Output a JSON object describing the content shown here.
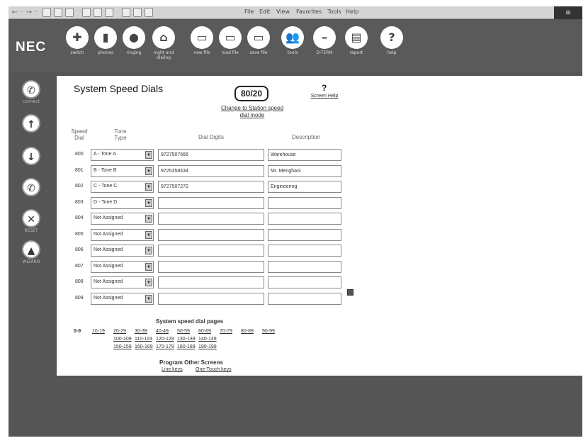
{
  "menu": {
    "nav": [
      "←",
      "·",
      "→",
      "·"
    ],
    "items": [
      "File",
      "Edit",
      "View",
      "Favorites",
      "Tools",
      "Help"
    ]
  },
  "brand": {
    "logo": "NEC"
  },
  "toolbar": [
    {
      "id": "switch",
      "icon": "plus-icon",
      "glyph": "✚",
      "label": "switch"
    },
    {
      "id": "phones",
      "icon": "phone-icon",
      "glyph": "▮",
      "label": "phones"
    },
    {
      "id": "ringing",
      "icon": "ringing-icon",
      "glyph": "●",
      "label": "ringing"
    },
    {
      "id": "night",
      "icon": "lock-icon",
      "glyph": "⌂",
      "label": "night and dialing"
    },
    {
      "id": "newfile",
      "icon": "folder-new-icon",
      "glyph": "▭",
      "label": "new file"
    },
    {
      "id": "loadfile",
      "icon": "folder-open-icon",
      "glyph": "▭",
      "label": "load file"
    },
    {
      "id": "savefile",
      "icon": "folder-save-icon",
      "glyph": "▭",
      "label": "save file"
    },
    {
      "id": "tools",
      "icon": "people-icon",
      "glyph": "👥",
      "label": "tools"
    },
    {
      "id": "dterm",
      "icon": "dterm-icon",
      "glyph": "–",
      "label": "D-TERM"
    },
    {
      "id": "report",
      "icon": "report-icon",
      "glyph": "▤",
      "label": "report"
    },
    {
      "id": "help",
      "icon": "help-icon",
      "glyph": "?",
      "label": "help"
    }
  ],
  "sidebar": [
    {
      "id": "connect",
      "icon": "connect-icon",
      "glyph": "✆",
      "label": "connect"
    },
    {
      "id": "upload",
      "icon": "up-arrow-icon",
      "glyph": "↑",
      "label": ""
    },
    {
      "id": "download",
      "icon": "down-arrow-icon",
      "glyph": "↓",
      "label": ""
    },
    {
      "id": "disconnect",
      "icon": "disconnect-icon",
      "glyph": "✆",
      "label": ""
    },
    {
      "id": "reset",
      "icon": "reset-icon",
      "glyph": "✕",
      "label": "RESET"
    },
    {
      "id": "wizard",
      "icon": "wizard-icon",
      "glyph": "▲",
      "label": "WIZARD"
    }
  ],
  "page": {
    "title": "System Speed Dials",
    "mode": "80/20",
    "change_mode": "Change to Station speed dial mode",
    "help_q": "?",
    "screen_help": "Screen Help",
    "headers": {
      "speed_dial": "Speed Dial",
      "tone_type": "Tone Type",
      "digits": "Dial Digits",
      "description": "Description"
    },
    "rows": [
      {
        "num": "800",
        "tone": "A - Tone A",
        "digits": "9727507666",
        "desc": "Warehouse"
      },
      {
        "num": "801",
        "tone": "B - Tone B",
        "digits": "9725358434",
        "desc": "Mr. Menghani"
      },
      {
        "num": "802",
        "tone": "C - Tone C",
        "digits": "9727507272",
        "desc": "Engineering"
      },
      {
        "num": "803",
        "tone": "D - Tone D",
        "digits": "",
        "desc": ""
      },
      {
        "num": "804",
        "tone": "Not Assigned",
        "digits": "",
        "desc": ""
      },
      {
        "num": "805",
        "tone": "Not Assigned",
        "digits": "",
        "desc": ""
      },
      {
        "num": "806",
        "tone": "Not Assigned",
        "digits": "",
        "desc": ""
      },
      {
        "num": "807",
        "tone": "Not Assigned",
        "digits": "",
        "desc": ""
      },
      {
        "num": "808",
        "tone": "Not Assigned",
        "digits": "",
        "desc": ""
      },
      {
        "num": "809",
        "tone": "Not Assigned",
        "digits": "",
        "desc": ""
      }
    ],
    "pages_title": "System speed dial pages",
    "current_page": "0-9",
    "page_links": [
      "10-19",
      "20-29",
      "30-39",
      "40-49",
      "50-59",
      "60-69",
      "70-79",
      "80-89",
      "90-99",
      "100-109",
      "110-119",
      "120-129",
      "130-139",
      "140-149",
      "150-159",
      "160-169",
      "170-179",
      "180-189",
      "190-199"
    ],
    "other_title": "Program Other Screens",
    "other_links": [
      "Line keys",
      "One-Touch keys"
    ]
  }
}
